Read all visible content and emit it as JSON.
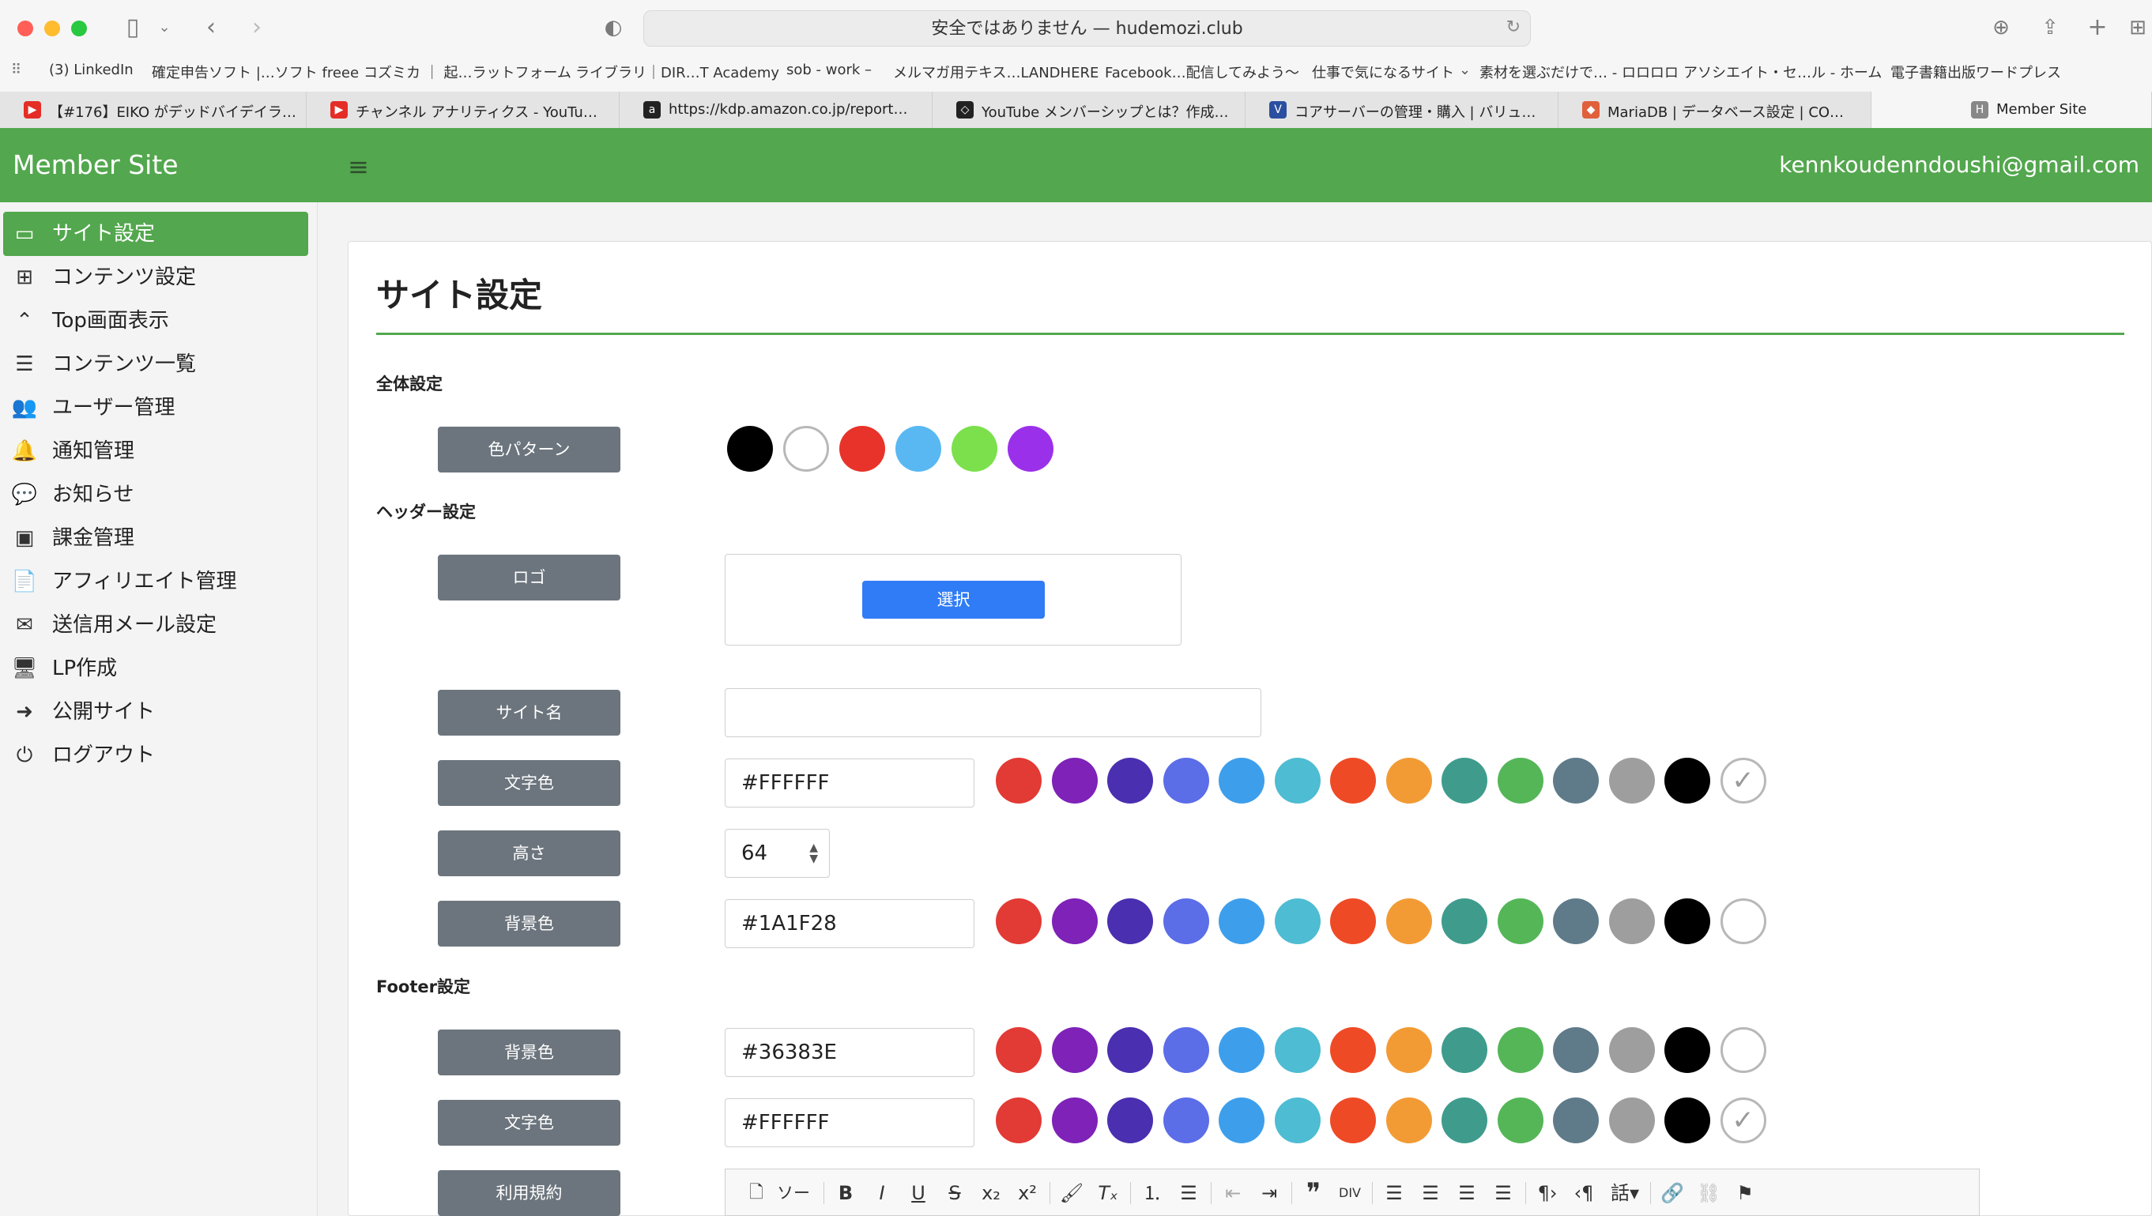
{
  "browser": {
    "url_text": "安全ではありません — hudemozi.club",
    "bookmarks": [
      "(3) LinkedIn",
      "確定申告ソフト |…ソフト freee",
      "コズミカ ｜ 起…ラットフォーム",
      "ライブラリ｜DIR…T Academy",
      "sob - work –",
      "メルマガ用テキス…LANDHERE",
      "Facebook…配信してみよう〜",
      "仕事で気になるサイト",
      "素材を選ぶだけで… - ロロロロ",
      "アソシエイト・セ…ル - ホーム",
      "電子書籍出版ワードプレス"
    ],
    "tabs": [
      {
        "label": "【#176】EIKO がデッドバイデイラ…",
        "fav": "▶",
        "fav_color": "#e52d27"
      },
      {
        "label": "チャンネル アナリティクス - YouTu…",
        "fav": "▶",
        "fav_color": "#e52d27"
      },
      {
        "label": "https://kdp.amazon.co.jp/report…",
        "fav": "a",
        "fav_color": "#222"
      },
      {
        "label": "YouTube メンバーシップとは？作成…",
        "fav": "◇",
        "fav_color": "#222"
      },
      {
        "label": "コアサーバーの管理・購入 | バリュ…",
        "fav": "V",
        "fav_color": "#2b4fa0"
      },
      {
        "label": "MariaDB | データベース設定 | CO…",
        "fav": "◆",
        "fav_color": "#e0603c"
      },
      {
        "label": "Member Site",
        "fav": "H",
        "fav_color": "#888"
      }
    ]
  },
  "header": {
    "brand": "Member Site",
    "email": "kennkoudenndoushi@gmail.com"
  },
  "sidebar": {
    "items": [
      {
        "label": "サイト設定",
        "icon": "▭"
      },
      {
        "label": "コンテンツ設定",
        "icon": "⊞"
      },
      {
        "label": "Top画面表示",
        "icon": "⌃"
      },
      {
        "label": "コンテンツ一覧",
        "icon": "☰"
      },
      {
        "label": "ユーザー管理",
        "icon": "👥"
      },
      {
        "label": "通知管理",
        "icon": "🔔"
      },
      {
        "label": "お知らせ",
        "icon": "💬"
      },
      {
        "label": "課金管理",
        "icon": "▣"
      },
      {
        "label": "アフィリエイト管理",
        "icon": "📄"
      },
      {
        "label": "送信用メール設定",
        "icon": "✉"
      },
      {
        "label": "LP作成",
        "icon": "🖥"
      },
      {
        "label": "公開サイト",
        "icon": "➜"
      },
      {
        "label": "ログアウト",
        "icon": "⏻"
      }
    ]
  },
  "page": {
    "title": "サイト設定",
    "sections": {
      "general": "全体設定",
      "header": "ヘッダー設定",
      "footer": "Footer設定"
    },
    "labels": {
      "color_pattern": "色パターン",
      "logo": "ロゴ",
      "site_name": "サイト名",
      "text_color": "文字色",
      "height": "高さ",
      "bg_color": "背景色",
      "footer_bg": "背景色",
      "footer_text": "文字色",
      "terms": "利用規約"
    },
    "select_button": "選択",
    "values": {
      "site_name": "",
      "header_text_color": "#FFFFFF",
      "header_height": "64",
      "header_bg_color": "#1A1F28",
      "footer_bg_color": "#36383E",
      "footer_text_color": "#FFFFFF"
    },
    "editor_source_label": "ソース"
  },
  "colors": {
    "pattern": [
      "#000000",
      "#ffffff",
      "#e8332a",
      "#59b8f2",
      "#7be04b",
      "#9b30ea"
    ],
    "palette": [
      "#e23a35",
      "#7e22b8",
      "#4a2fb0",
      "#5c6de8",
      "#3d9fec",
      "#4ebcd2",
      "#ef4a26",
      "#f29b35",
      "#3f9c8d",
      "#55b658",
      "#5f7b8a",
      "#9e9e9e",
      "#000000",
      "#ffffff"
    ],
    "accent": "#53a74e",
    "label_button": "#6c757d",
    "primary": "#2f7cf6"
  }
}
